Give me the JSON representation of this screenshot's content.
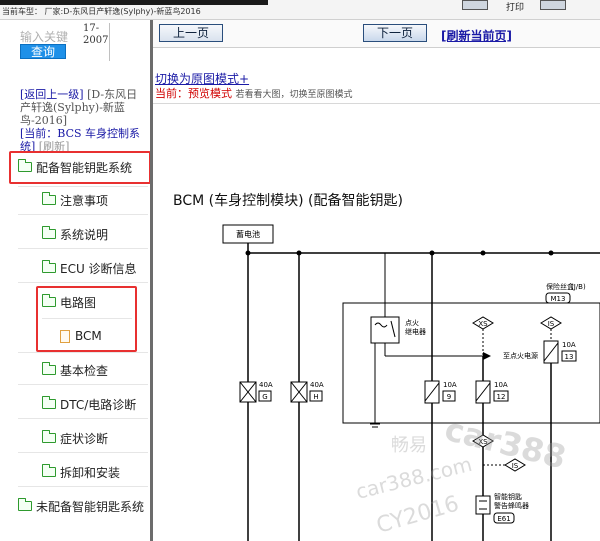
{
  "topbar": {
    "title": "当前车型：  厂家:D-东风日产轩逸(Sylphy)-新蓝鸟2016",
    "print_label": "打印"
  },
  "left": {
    "search_label": "输入关键",
    "search_button": "查询",
    "date_line1": "17-",
    "date_line2": "2007",
    "nav": {
      "back_link": "[返回上一级]",
      "model": "[D-东风日产轩逸(Sylphy)-新蓝鸟-2016]",
      "current_prefix": "[当前：",
      "current_value": "BCS 车身控制系统",
      "current_suffix": "]",
      "refresh": "[刷新]"
    },
    "tree": [
      {
        "label": "配备智能钥匙系统",
        "type": "folder"
      },
      {
        "label": "注意事项",
        "type": "folder"
      },
      {
        "label": "系统说明",
        "type": "folder"
      },
      {
        "label": "ECU 诊断信息",
        "type": "folder"
      },
      {
        "label": "电路图",
        "type": "folder"
      },
      {
        "label": "BCM",
        "type": "file"
      },
      {
        "label": "基本检查",
        "type": "folder"
      },
      {
        "label": "DTC/电路诊断",
        "type": "folder"
      },
      {
        "label": "症状诊断",
        "type": "folder"
      },
      {
        "label": "拆卸和安装",
        "type": "folder"
      },
      {
        "label": "未配备智能钥匙系统",
        "type": "folder"
      }
    ]
  },
  "right": {
    "prev_button": "上一页",
    "next_button": "下一页",
    "refresh_link": "[刷新当前页]",
    "mode_link": "切换为原图模式+",
    "mode_prefix": "当前：",
    "mode_value": "预览模式",
    "mode_note": "若看看大图，切换至原图模式",
    "doc_title": "BCM (车身控制模块) (配备智能钥匙)",
    "diagram": {
      "battery": "蓄电池",
      "fusebox_title": "保险丝盒",
      "fusebox_code": "(J/B)",
      "fusebox_conn": "M13",
      "relay_label_1": "点火",
      "relay_label_2": "继电器",
      "to_ign": "至点火电源",
      "xs1": "XS",
      "is1": "IS",
      "xs2": "XS",
      "is2": "IS",
      "fuse_main_g_amp": "40A",
      "fuse_main_g_id": "G",
      "fuse_main_h_amp": "40A",
      "fuse_main_h_id": "H",
      "fuse9_amp": "10A",
      "fuse9_id": "9",
      "fuse12_amp": "10A",
      "fuse12_id": "12",
      "fuse13_amp": "10A",
      "fuse13_id": "13",
      "buzzer_1": "智能钥匙",
      "buzzer_2": "警告蜂鸣器",
      "buzzer_conn": "E61"
    },
    "watermark": [
      "畅易",
      "car388",
      "car388.com",
      "CY2016"
    ]
  },
  "colors": {
    "search_button": "#1e90e8",
    "highlight": "#e83030",
    "link": "#1a1aa6",
    "alert": "#d00000",
    "folder": "#2e9a2e"
  }
}
